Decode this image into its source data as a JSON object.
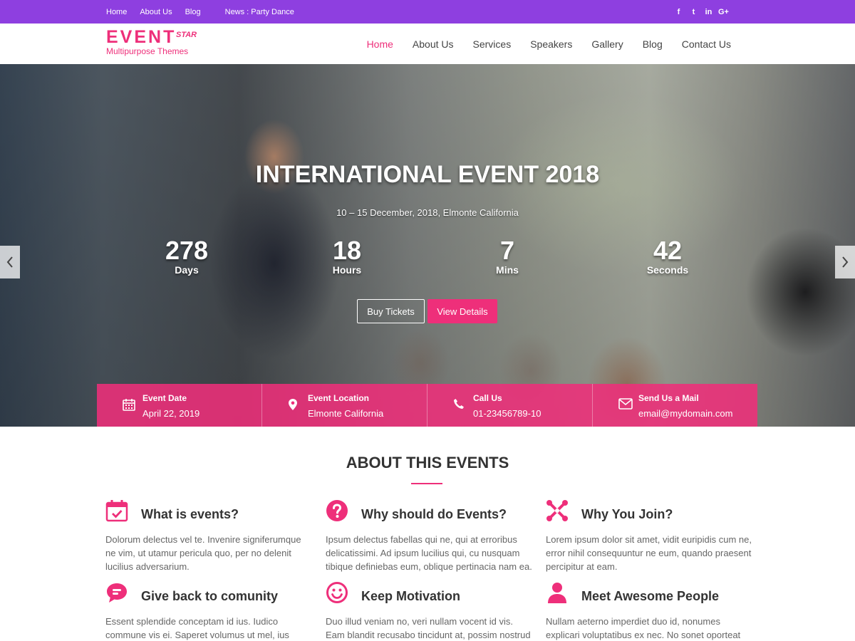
{
  "topbar": {
    "links": [
      "Home",
      "About Us",
      "Blog"
    ],
    "news": "News : Party Dance",
    "social": [
      "f",
      "t",
      "in",
      "G+"
    ]
  },
  "logo": {
    "brand": "EVENT",
    "star": "STAR",
    "tagline": "Multipurpose Themes"
  },
  "nav": {
    "items": [
      "Home",
      "About Us",
      "Services",
      "Speakers",
      "Gallery",
      "Blog",
      "Contact Us"
    ],
    "active": "Home"
  },
  "hero": {
    "title": "INTERNATIONAL EVENT 2018",
    "dates": "10 – 15 December, 2018, Elmonte California",
    "countdown": [
      {
        "num": "278",
        "unit": "Days"
      },
      {
        "num": "18",
        "unit": "Hours"
      },
      {
        "num": "7",
        "unit": "Mins"
      },
      {
        "num": "42",
        "unit": "Seconds"
      }
    ],
    "buy_label": "Buy Tickets",
    "view_label": "View Details",
    "prev_icon": "chevron-left-icon",
    "next_icon": "chevron-right-icon"
  },
  "info": [
    {
      "icon": "calendar-icon",
      "title": "Event Date",
      "value": "April 22, 2019"
    },
    {
      "icon": "location-pin-icon",
      "title": "Event Location",
      "value": "Elmonte California"
    },
    {
      "icon": "phone-icon",
      "title": "Call Us",
      "value": "01-23456789-10"
    },
    {
      "icon": "envelope-icon",
      "title": "Send Us a Mail",
      "value": "email@mydomain.com"
    }
  ],
  "about": {
    "title": "ABOUT THIS EVENTS",
    "features": [
      {
        "icon": "calendar-check-icon",
        "title": "What is events?",
        "text": "Dolorum delectus vel te. Invenire signiferumque ne vim, ut utamur pericula quo, per no delenit lucilius adversarium."
      },
      {
        "icon": "question-circle-icon",
        "title": "Why should do Events?",
        "text": "Ipsum delectus fabellas qui ne, qui at erroribus delicatissimi. Ad ipsum lucilius qui, cu nusquam tibique definiebas eum, oblique pertinacia nam ea."
      },
      {
        "icon": "joomla-icon",
        "title": "Why You Join?",
        "text": "Lorem ipsum dolor sit amet, vidit euripidis cum ne, error nihil consequuntur ne eum, quando praesent percipitur at eam."
      },
      {
        "icon": "chat-bubble-icon",
        "title": "Give back to comunity",
        "text": "Essent splendide conceptam id ius. Iudico commune vis ei. Saperet volumus ut mel, ius"
      },
      {
        "icon": "smiley-icon",
        "title": "Keep Motivation",
        "text": "Duo illud veniam no, veri nullam vocent id vis. Eam blandit recusabo tincidunt at, possim nostrud"
      },
      {
        "icon": "user-icon",
        "title": "Meet Awesome People",
        "text": "Nullam aeterno imperdiet duo id, nonumes explicari voluptatibus ex nec. No sonet oporteat"
      }
    ]
  },
  "colors": {
    "topbar": "#8e3fe0",
    "accent": "#ee2f7a"
  }
}
